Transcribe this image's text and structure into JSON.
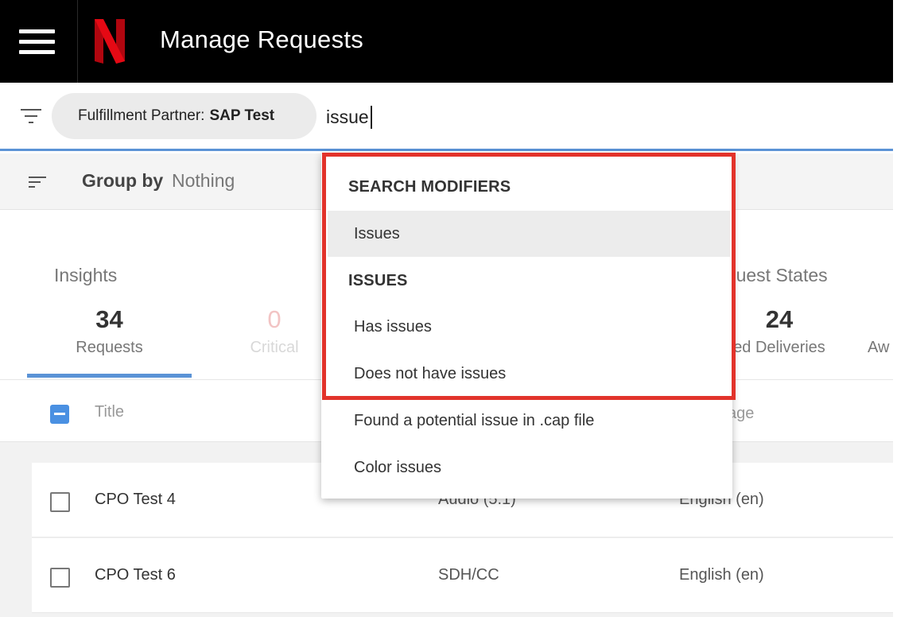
{
  "app": {
    "title": "Manage Requests",
    "brand_letter": "N",
    "brand_color": "#e50914"
  },
  "search": {
    "filter_chip": {
      "label": "Fulfillment Partner:",
      "value": "SAP Test"
    },
    "query": "issue"
  },
  "group_by": {
    "label": "Group by",
    "value": "Nothing"
  },
  "insights": {
    "title": "Insights",
    "stats": [
      {
        "value": "34",
        "label": "Requests"
      },
      {
        "value": "0",
        "label": "Critical"
      }
    ]
  },
  "request_states": {
    "title": "equest States",
    "stats": [
      {
        "value": "24",
        "label": "ed Deliveries"
      },
      {
        "value": "",
        "label": "Aw"
      }
    ]
  },
  "table": {
    "columns": {
      "title": "Title",
      "language": "age"
    },
    "rows": [
      {
        "title": "CPO Test 4",
        "type": "Audio (5.1)",
        "language": "English (en)"
      },
      {
        "title": "CPO Test 6",
        "type": "SDH/CC",
        "language": "English (en)"
      }
    ]
  },
  "dropdown": {
    "sections": [
      {
        "header": "SEARCH MODIFIERS",
        "items": [
          "Issues"
        ]
      },
      {
        "header": "ISSUES",
        "items": [
          "Has issues",
          "Does not have issues",
          "Found a potential issue in .cap file",
          "Color issues"
        ]
      }
    ],
    "active_item": "Issues"
  },
  "colors": {
    "accent": "#5b93d6",
    "highlight": "#e2332b",
    "checkbox": "#4a90e2"
  },
  "icons": [
    "hamburger-menu-icon",
    "netflix-logo",
    "filter-icon",
    "sort-icon"
  ]
}
